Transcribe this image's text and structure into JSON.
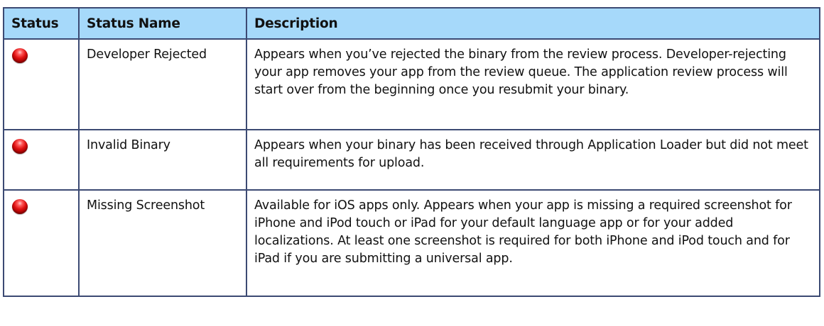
{
  "table": {
    "headers": [
      "Status",
      "Status Name",
      "Description"
    ],
    "rows": [
      {
        "status_icon": "red-status-dot-icon",
        "name": "Developer Rejected",
        "description": "Appears when you’ve rejected the binary from the review process. Developer-rejecting your app removes your app from the review queue. The application review process will start over from the beginning once you resubmit your binary."
      },
      {
        "status_icon": "red-status-dot-icon",
        "name": "Invalid Binary",
        "description": "Appears when your binary has been received through Application Loader but did not meet all requirements for upload."
      },
      {
        "status_icon": "red-status-dot-icon",
        "name": "Missing Screenshot",
        "description": "Available for iOS apps only. Appears when your app is missing a required screenshot for iPhone and iPod touch or iPad for your default language app or for your added localizations.  At least one screenshot is required for both iPhone and iPod touch and for iPad if you are submitting a universal app."
      }
    ]
  },
  "colors": {
    "header_background": "#a6d9fa",
    "border": "#3c4a73",
    "status_red": "#e01010"
  }
}
